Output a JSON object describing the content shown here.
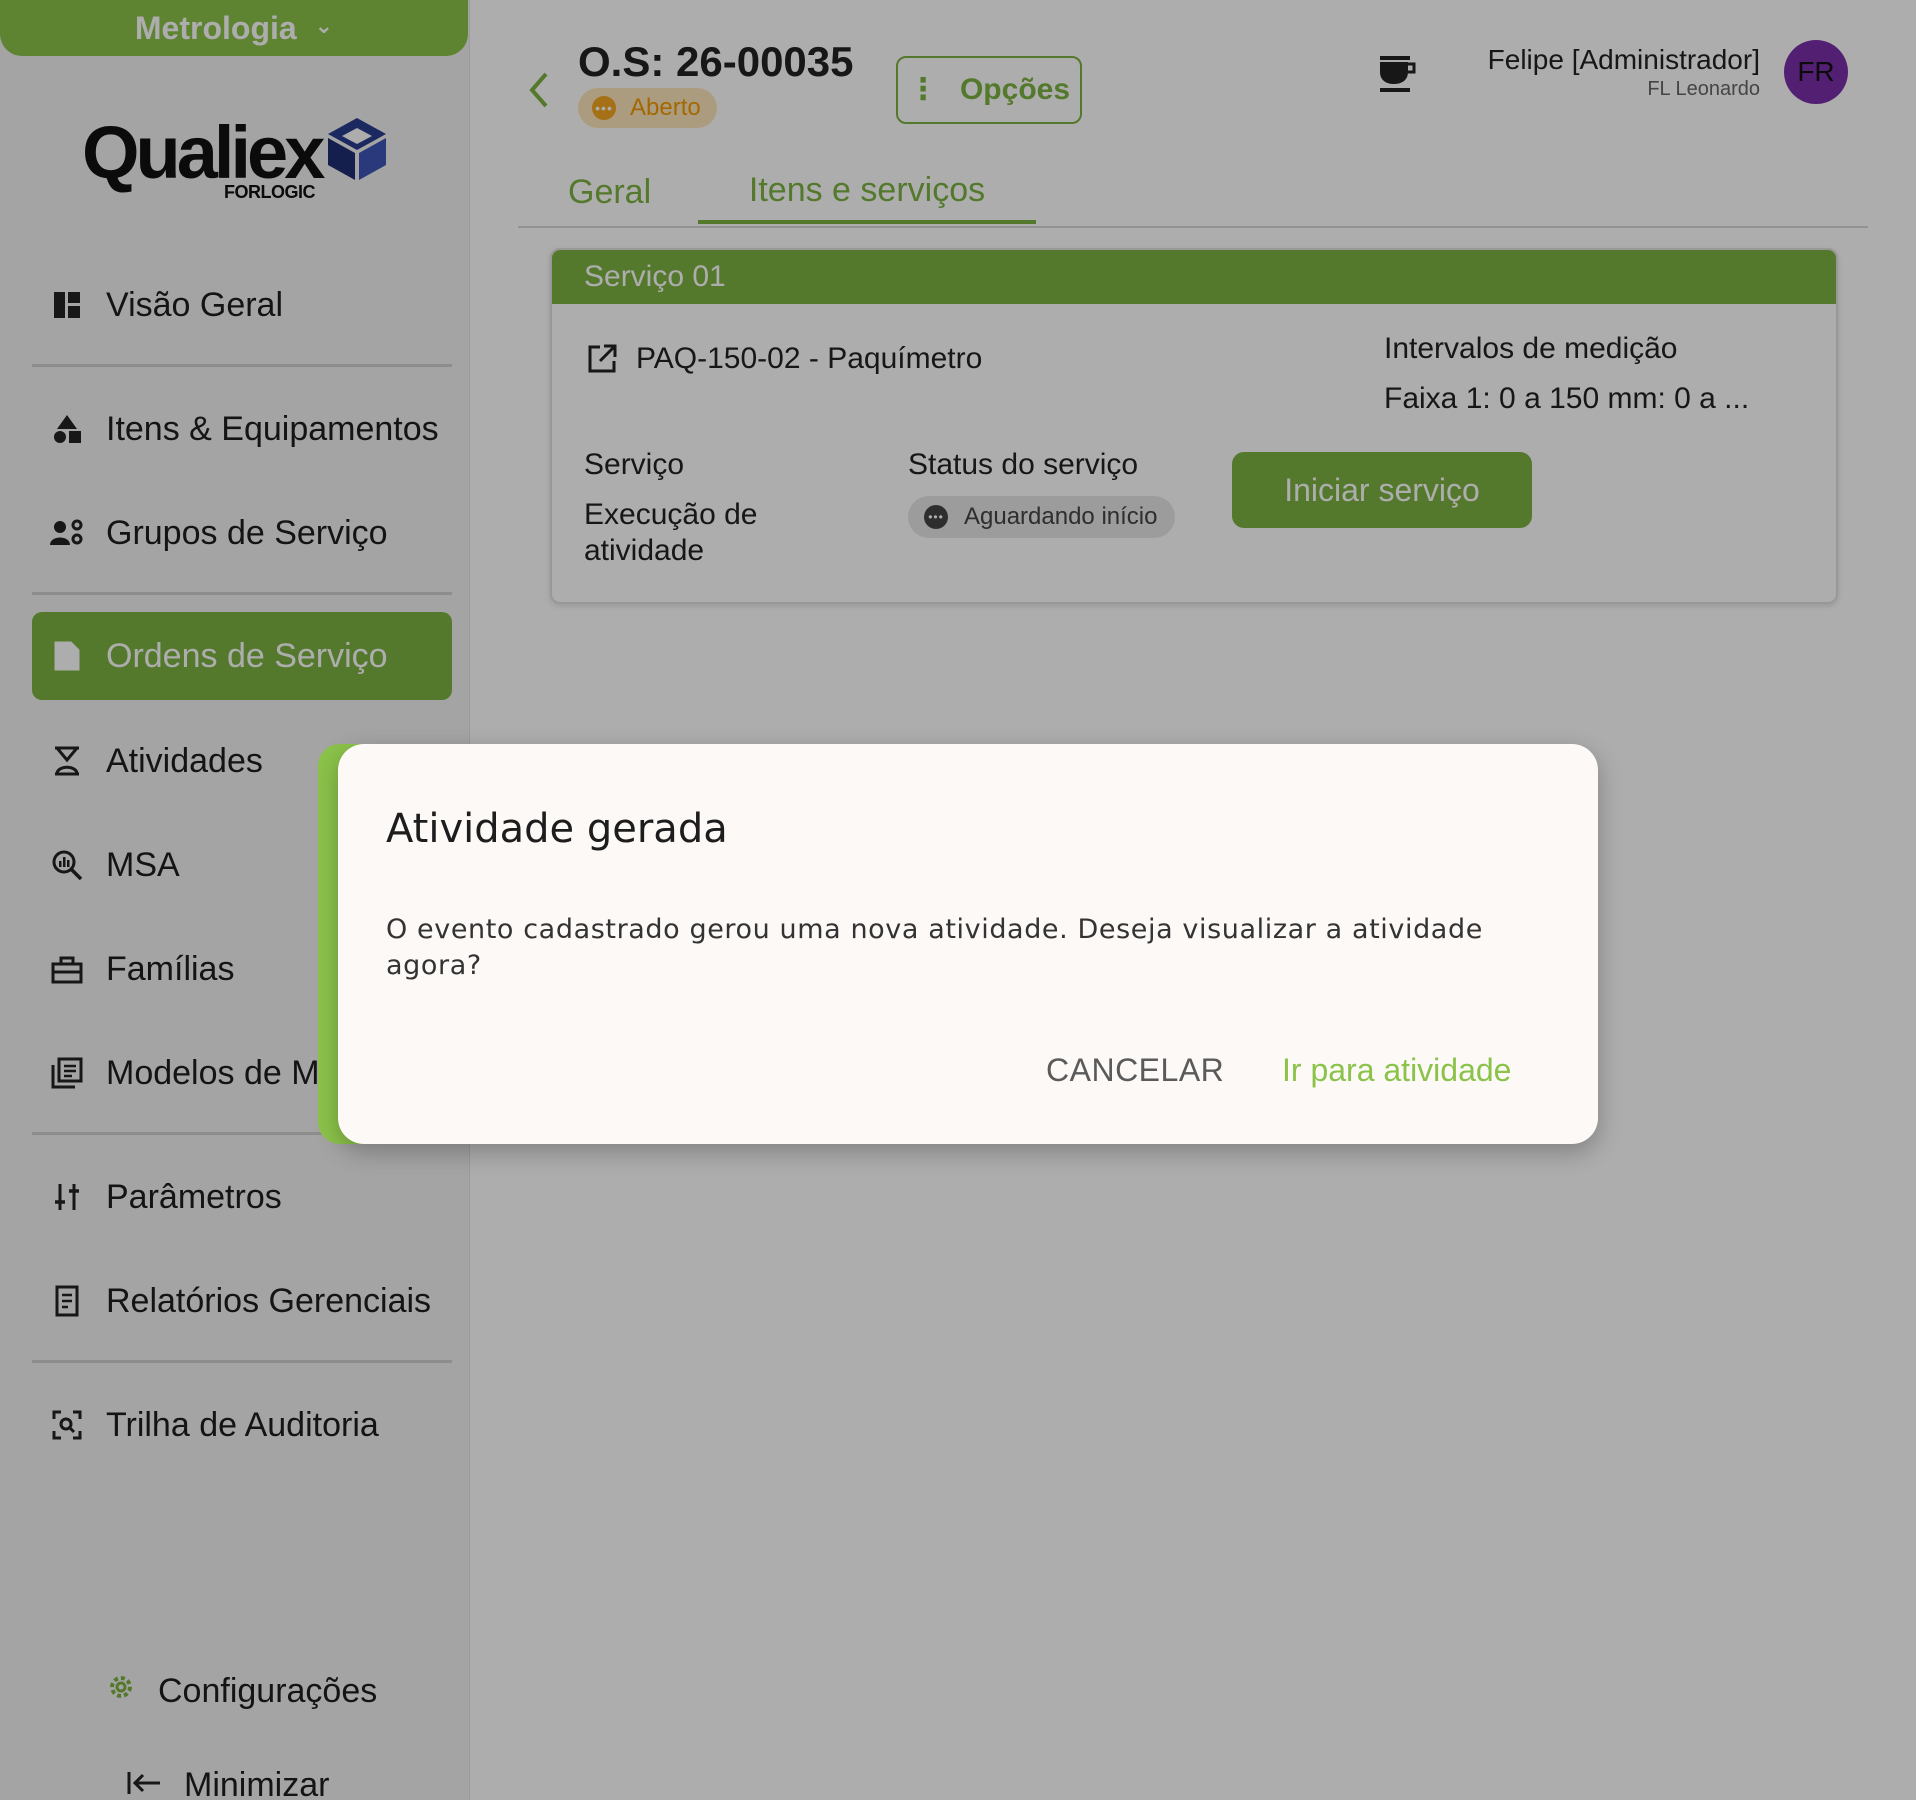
{
  "sidebar": {
    "module": "Metrologia",
    "logo": {
      "word": "Qualiex",
      "sub": "FORLOGIC"
    },
    "items": [
      {
        "label": "Visão Geral",
        "icon": "dashboard-icon"
      },
      {
        "label": "Itens & Equipamentos",
        "icon": "shapes-icon"
      },
      {
        "label": "Grupos de Serviço",
        "icon": "group-settings-icon"
      },
      {
        "label": "Ordens de Serviço",
        "icon": "document-icon",
        "active": true
      },
      {
        "label": "Atividades",
        "icon": "hourglass-icon"
      },
      {
        "label": "MSA",
        "icon": "analytics-search-icon"
      },
      {
        "label": "Famílias",
        "icon": "toolbox-icon"
      },
      {
        "label": "Modelos de Me",
        "icon": "library-books-icon"
      },
      {
        "label": "Parâmetros",
        "icon": "sliders-icon"
      },
      {
        "label": "Relatórios Gerenciais",
        "icon": "report-icon"
      },
      {
        "label": "Trilha de Auditoria",
        "icon": "scan-icon"
      }
    ],
    "settings": "Configurações",
    "minimize": "Minimizar"
  },
  "header": {
    "title": "O.S: 26-00035",
    "status": "Aberto",
    "options": "Opções",
    "user_name": "Felipe [Administrador]",
    "user_org": "FL Leonardo",
    "avatar": "FR"
  },
  "tabs": [
    {
      "label": "Geral",
      "active": false
    },
    {
      "label": "Itens e serviços",
      "active": true
    }
  ],
  "card": {
    "title": "Serviço 01",
    "item": "PAQ-150-02 - Paquímetro",
    "intervals_label": "Intervalos de medição",
    "intervals_value": "Faixa 1: 0 a 150 mm: 0 a ...",
    "service_label": "Serviço",
    "service_value_1": "Execução de",
    "service_value_2": "atividade",
    "status_label": "Status do serviço",
    "status_value": "Aguardando início",
    "start_button": "Iniciar serviço"
  },
  "dialog": {
    "title": "Atividade gerada",
    "text": "O evento cadastrado gerou uma nova atividade. Deseja visualizar a atividade agora?",
    "cancel": "CANCELAR",
    "confirm": "Ir para atividade"
  },
  "colors": {
    "accent": "#7cb342",
    "accent_light": "#8bc34a",
    "status_open": "#f5a623",
    "avatar": "#7b2fa8"
  }
}
